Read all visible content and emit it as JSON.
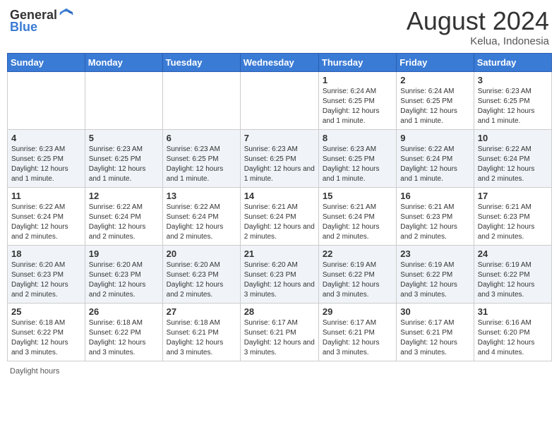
{
  "header": {
    "logo": {
      "general": "General",
      "blue": "Blue"
    },
    "title": "August 2024",
    "location": "Kelua, Indonesia"
  },
  "days_of_week": [
    "Sunday",
    "Monday",
    "Tuesday",
    "Wednesday",
    "Thursday",
    "Friday",
    "Saturday"
  ],
  "weeks": [
    [
      {
        "day": "",
        "info": ""
      },
      {
        "day": "",
        "info": ""
      },
      {
        "day": "",
        "info": ""
      },
      {
        "day": "",
        "info": ""
      },
      {
        "day": "1",
        "info": "Sunrise: 6:24 AM\nSunset: 6:25 PM\nDaylight: 12 hours and 1 minute."
      },
      {
        "day": "2",
        "info": "Sunrise: 6:24 AM\nSunset: 6:25 PM\nDaylight: 12 hours and 1 minute."
      },
      {
        "day": "3",
        "info": "Sunrise: 6:23 AM\nSunset: 6:25 PM\nDaylight: 12 hours and 1 minute."
      }
    ],
    [
      {
        "day": "4",
        "info": "Sunrise: 6:23 AM\nSunset: 6:25 PM\nDaylight: 12 hours and 1 minute."
      },
      {
        "day": "5",
        "info": "Sunrise: 6:23 AM\nSunset: 6:25 PM\nDaylight: 12 hours and 1 minute."
      },
      {
        "day": "6",
        "info": "Sunrise: 6:23 AM\nSunset: 6:25 PM\nDaylight: 12 hours and 1 minute."
      },
      {
        "day": "7",
        "info": "Sunrise: 6:23 AM\nSunset: 6:25 PM\nDaylight: 12 hours and 1 minute."
      },
      {
        "day": "8",
        "info": "Sunrise: 6:23 AM\nSunset: 6:25 PM\nDaylight: 12 hours and 1 minute."
      },
      {
        "day": "9",
        "info": "Sunrise: 6:22 AM\nSunset: 6:24 PM\nDaylight: 12 hours and 1 minute."
      },
      {
        "day": "10",
        "info": "Sunrise: 6:22 AM\nSunset: 6:24 PM\nDaylight: 12 hours and 2 minutes."
      }
    ],
    [
      {
        "day": "11",
        "info": "Sunrise: 6:22 AM\nSunset: 6:24 PM\nDaylight: 12 hours and 2 minutes."
      },
      {
        "day": "12",
        "info": "Sunrise: 6:22 AM\nSunset: 6:24 PM\nDaylight: 12 hours and 2 minutes."
      },
      {
        "day": "13",
        "info": "Sunrise: 6:22 AM\nSunset: 6:24 PM\nDaylight: 12 hours and 2 minutes."
      },
      {
        "day": "14",
        "info": "Sunrise: 6:21 AM\nSunset: 6:24 PM\nDaylight: 12 hours and 2 minutes."
      },
      {
        "day": "15",
        "info": "Sunrise: 6:21 AM\nSunset: 6:24 PM\nDaylight: 12 hours and 2 minutes."
      },
      {
        "day": "16",
        "info": "Sunrise: 6:21 AM\nSunset: 6:23 PM\nDaylight: 12 hours and 2 minutes."
      },
      {
        "day": "17",
        "info": "Sunrise: 6:21 AM\nSunset: 6:23 PM\nDaylight: 12 hours and 2 minutes."
      }
    ],
    [
      {
        "day": "18",
        "info": "Sunrise: 6:20 AM\nSunset: 6:23 PM\nDaylight: 12 hours and 2 minutes."
      },
      {
        "day": "19",
        "info": "Sunrise: 6:20 AM\nSunset: 6:23 PM\nDaylight: 12 hours and 2 minutes."
      },
      {
        "day": "20",
        "info": "Sunrise: 6:20 AM\nSunset: 6:23 PM\nDaylight: 12 hours and 2 minutes."
      },
      {
        "day": "21",
        "info": "Sunrise: 6:20 AM\nSunset: 6:23 PM\nDaylight: 12 hours and 3 minutes."
      },
      {
        "day": "22",
        "info": "Sunrise: 6:19 AM\nSunset: 6:22 PM\nDaylight: 12 hours and 3 minutes."
      },
      {
        "day": "23",
        "info": "Sunrise: 6:19 AM\nSunset: 6:22 PM\nDaylight: 12 hours and 3 minutes."
      },
      {
        "day": "24",
        "info": "Sunrise: 6:19 AM\nSunset: 6:22 PM\nDaylight: 12 hours and 3 minutes."
      }
    ],
    [
      {
        "day": "25",
        "info": "Sunrise: 6:18 AM\nSunset: 6:22 PM\nDaylight: 12 hours and 3 minutes."
      },
      {
        "day": "26",
        "info": "Sunrise: 6:18 AM\nSunset: 6:22 PM\nDaylight: 12 hours and 3 minutes."
      },
      {
        "day": "27",
        "info": "Sunrise: 6:18 AM\nSunset: 6:21 PM\nDaylight: 12 hours and 3 minutes."
      },
      {
        "day": "28",
        "info": "Sunrise: 6:17 AM\nSunset: 6:21 PM\nDaylight: 12 hours and 3 minutes."
      },
      {
        "day": "29",
        "info": "Sunrise: 6:17 AM\nSunset: 6:21 PM\nDaylight: 12 hours and 3 minutes."
      },
      {
        "day": "30",
        "info": "Sunrise: 6:17 AM\nSunset: 6:21 PM\nDaylight: 12 hours and 3 minutes."
      },
      {
        "day": "31",
        "info": "Sunrise: 6:16 AM\nSunset: 6:20 PM\nDaylight: 12 hours and 4 minutes."
      }
    ]
  ],
  "footer": {
    "text": "Daylight hours"
  },
  "colors": {
    "header_bg": "#3a7bd5",
    "accent": "#3a7bd5"
  }
}
